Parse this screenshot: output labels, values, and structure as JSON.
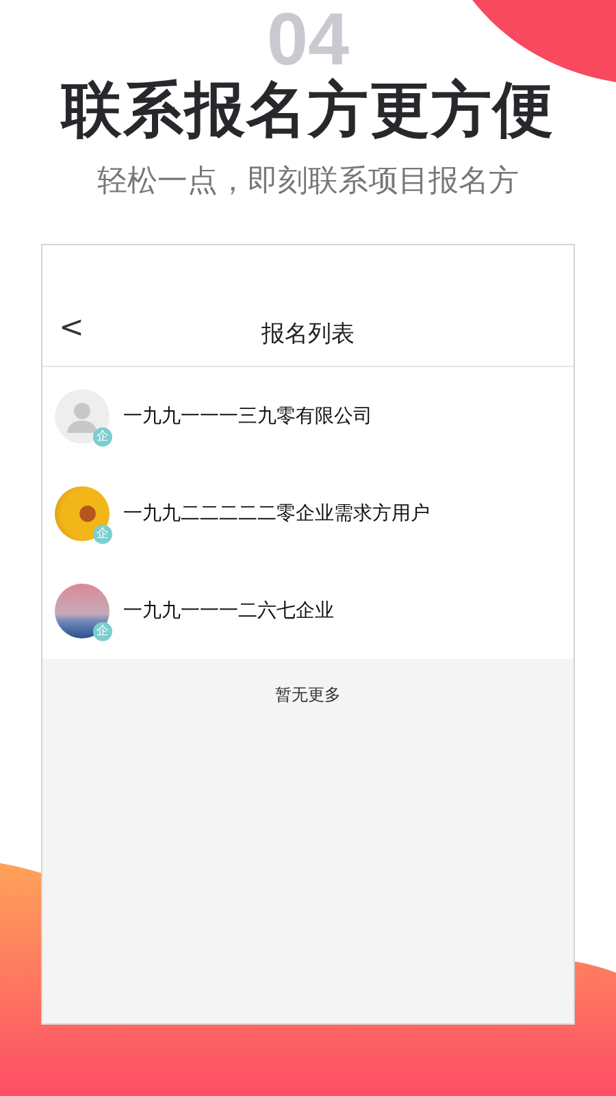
{
  "promo": {
    "number": "04",
    "title": "联系报名方更方便",
    "subtitle": "轻松一点，即刻联系项目报名方"
  },
  "screen": {
    "header": {
      "back": "<",
      "title": "报名列表"
    },
    "items": [
      {
        "name": "一九九一一一三九零有限公司",
        "kind": "default",
        "badge": "企"
      },
      {
        "name": "一九九二二二二二零企业需求方用户",
        "kind": "sunflower",
        "badge": "企"
      },
      {
        "name": "一九九一一一二六七企业",
        "kind": "sky",
        "badge": "企"
      }
    ],
    "footer": "暂无更多"
  }
}
